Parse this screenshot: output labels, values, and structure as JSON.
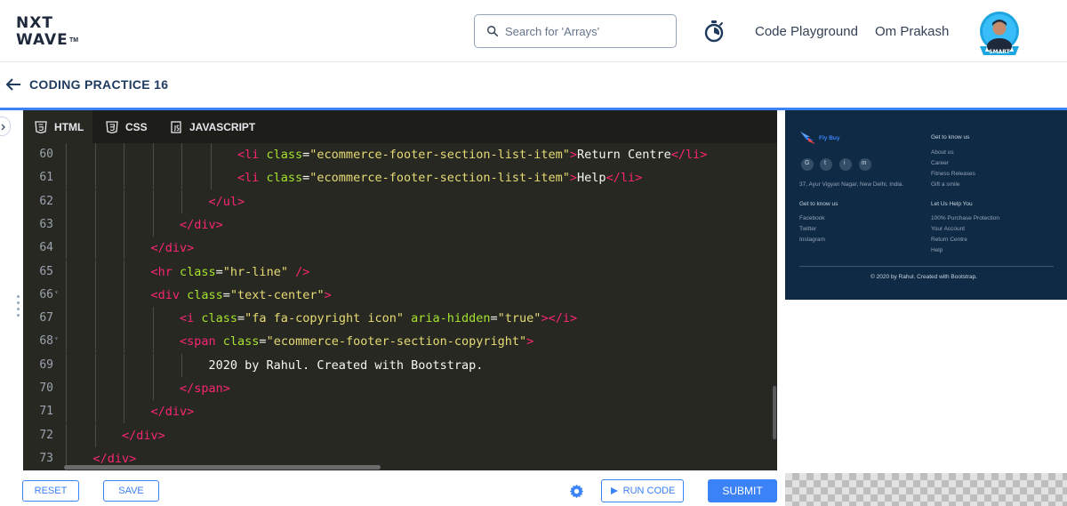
{
  "header": {
    "logo_line1": "NXT",
    "logo_line2": "WAVE",
    "logo_tm": "TM",
    "search_placeholder": "Search for 'Arrays'",
    "code_playground": "Code Playground",
    "user_name": "Om Prakash",
    "avatar_badge": "SMART"
  },
  "page": {
    "title": "CODING PRACTICE 16"
  },
  "editor": {
    "tabs": [
      {
        "label": "HTML",
        "active": true
      },
      {
        "label": "CSS",
        "active": false
      },
      {
        "label": "JAVASCRIPT",
        "active": false
      }
    ],
    "lines": [
      {
        "n": "60",
        "fold": false,
        "depth": 6,
        "tokens": [
          [
            "tg",
            "<li "
          ],
          [
            "at",
            "class"
          ],
          [
            "tx",
            "="
          ],
          [
            "st",
            "\"ecommerce-footer-section-list-item\""
          ],
          [
            "tg",
            ">"
          ],
          [
            "tx",
            "Return Centre"
          ],
          [
            "tg",
            "</li>"
          ]
        ]
      },
      {
        "n": "61",
        "fold": false,
        "depth": 6,
        "tokens": [
          [
            "tg",
            "<li "
          ],
          [
            "at",
            "class"
          ],
          [
            "tx",
            "="
          ],
          [
            "st",
            "\"ecommerce-footer-section-list-item\""
          ],
          [
            "tg",
            ">"
          ],
          [
            "tx",
            "Help"
          ],
          [
            "tg",
            "</li>"
          ]
        ]
      },
      {
        "n": "62",
        "fold": false,
        "depth": 5,
        "tokens": [
          [
            "tg",
            "</ul>"
          ]
        ]
      },
      {
        "n": "63",
        "fold": false,
        "depth": 4,
        "tokens": [
          [
            "tg",
            "</div>"
          ]
        ]
      },
      {
        "n": "64",
        "fold": false,
        "depth": 3,
        "tokens": [
          [
            "tg",
            "</div>"
          ]
        ]
      },
      {
        "n": "65",
        "fold": false,
        "depth": 3,
        "tokens": [
          [
            "tg",
            "<hr "
          ],
          [
            "at",
            "class"
          ],
          [
            "tx",
            "="
          ],
          [
            "st",
            "\"hr-line\""
          ],
          [
            "tx",
            " "
          ],
          [
            "tg",
            "/>"
          ]
        ]
      },
      {
        "n": "66",
        "fold": true,
        "depth": 3,
        "tokens": [
          [
            "tg",
            "<div "
          ],
          [
            "at",
            "class"
          ],
          [
            "tx",
            "="
          ],
          [
            "st",
            "\"text-center\""
          ],
          [
            "tg",
            ">"
          ]
        ]
      },
      {
        "n": "67",
        "fold": false,
        "depth": 4,
        "tokens": [
          [
            "tg",
            "<i "
          ],
          [
            "at",
            "class"
          ],
          [
            "tx",
            "="
          ],
          [
            "st",
            "\"fa fa-copyright icon\""
          ],
          [
            "tx",
            " "
          ],
          [
            "at",
            "aria-hidden"
          ],
          [
            "tx",
            "="
          ],
          [
            "st",
            "\"true\""
          ],
          [
            "tg",
            "></i>"
          ]
        ]
      },
      {
        "n": "68",
        "fold": true,
        "depth": 4,
        "tokens": [
          [
            "tg",
            "<span "
          ],
          [
            "at",
            "class"
          ],
          [
            "tx",
            "="
          ],
          [
            "st",
            "\"ecommerce-footer-section-copyright\""
          ],
          [
            "tg",
            ">"
          ]
        ]
      },
      {
        "n": "69",
        "fold": false,
        "depth": 5,
        "tokens": [
          [
            "tx",
            "2020 by Rahul. Created with Bootstrap."
          ]
        ]
      },
      {
        "n": "70",
        "fold": false,
        "depth": 4,
        "tokens": [
          [
            "tg",
            "</span>"
          ]
        ]
      },
      {
        "n": "71",
        "fold": false,
        "depth": 3,
        "tokens": [
          [
            "tg",
            "</div>"
          ]
        ]
      },
      {
        "n": "72",
        "fold": false,
        "depth": 2,
        "tokens": [
          [
            "tg",
            "</div>"
          ]
        ]
      },
      {
        "n": "73",
        "fold": false,
        "depth": 1,
        "tokens": [
          [
            "tg",
            "</div>"
          ]
        ]
      }
    ]
  },
  "toolbar": {
    "reset": "RESET",
    "save": "SAVE",
    "run_code": "RUN CODE",
    "submit": "SUBMIT"
  },
  "preview": {
    "brand": "Fly Buy",
    "address": "37, Ayur Vigyan Nagar, New Delhi, India.",
    "col1_heading": "Get to know us",
    "col1_items": [
      "Facebook",
      "Twitter",
      "Instagram"
    ],
    "col2_heading": "Get to know us",
    "col2_items": [
      "About us",
      "Career",
      "Fitness Releases",
      "Gift a smile"
    ],
    "col3_heading": "Let Us Help You",
    "col3_items": [
      "100% Purchase Protection",
      "Your Account",
      "Return Centre",
      "Help"
    ],
    "social_icons": [
      "G",
      "t",
      "i",
      "in"
    ],
    "copyright": "2020 by Rahul. Created with Bootstrap."
  },
  "colors": {
    "accent": "#3b82f6",
    "editor_bg": "#272822",
    "preview_footer_bg": "#0f2a44"
  }
}
